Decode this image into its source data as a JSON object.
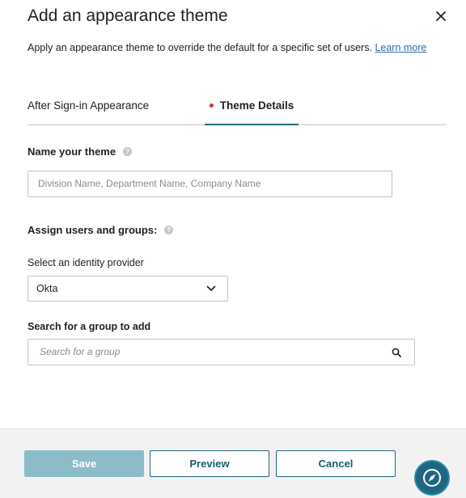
{
  "dialog": {
    "title": "Add an appearance theme",
    "description": "Apply an appearance theme to override the default for a specific set of users.",
    "learn_more": "Learn more"
  },
  "tabs": [
    {
      "label": "After Sign-in Appearance",
      "active": false
    },
    {
      "label": "Theme Details",
      "active": true
    }
  ],
  "theme_name": {
    "label": "Name your theme",
    "placeholder": "Division Name, Department Name, Company Name",
    "value": ""
  },
  "assign": {
    "label": "Assign users and groups:"
  },
  "identity_provider": {
    "label": "Select an identity provider",
    "selected": "Okta"
  },
  "group_search": {
    "label": "Search for a group to add",
    "placeholder": "Search for a group"
  },
  "footer": {
    "save_label": "Save",
    "preview_label": "Preview",
    "cancel_label": "Cancel"
  },
  "colors": {
    "accent": "#1d6a83",
    "save_disabled": "#8dbcc9",
    "tab_dot": "#d32f2f"
  },
  "icons": [
    "close-icon",
    "help-icon",
    "chevron-down-icon",
    "search-icon",
    "compass-icon"
  ]
}
